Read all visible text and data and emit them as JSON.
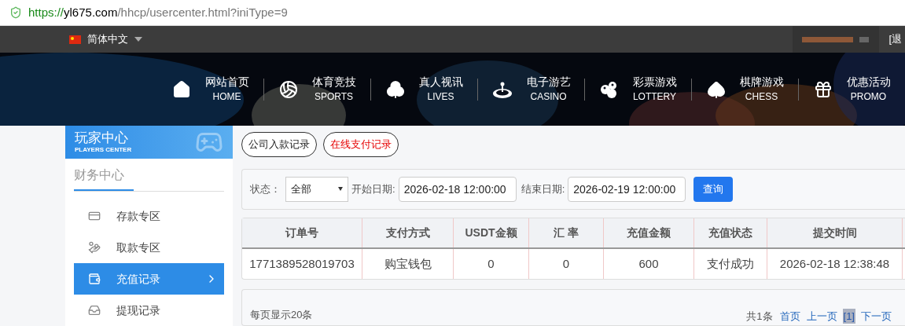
{
  "address_bar": {
    "scheme": "https://",
    "host": "yl675.com",
    "path": "/hhcp/usercenter.html?iniType=9"
  },
  "top_bar": {
    "language": "简体中文",
    "logout": "[退"
  },
  "nav": [
    {
      "kind": "home",
      "zh": "网站首页",
      "en": "HOME"
    },
    {
      "kind": "sports",
      "zh": "体育竞技",
      "en": "SPORTS"
    },
    {
      "kind": "live",
      "zh": "真人视讯",
      "en": "LIVES"
    },
    {
      "kind": "casino",
      "zh": "电子游艺",
      "en": "CASINO"
    },
    {
      "kind": "lottery",
      "zh": "彩票游戏",
      "en": "LOTTERY"
    },
    {
      "kind": "chess",
      "zh": "棋牌游戏",
      "en": "CHESS"
    },
    {
      "kind": "promo",
      "zh": "优惠活动",
      "en": "PROMO"
    }
  ],
  "sidebar": {
    "title": "玩家中心",
    "subtitle": "PLAYERS CENTER",
    "section": "财务中心",
    "items": [
      {
        "kind": "deposit",
        "label": "存款专区",
        "selected": false
      },
      {
        "kind": "withdraw",
        "label": "取款专区",
        "selected": false
      },
      {
        "kind": "recharge",
        "label": "充值记录",
        "selected": true
      },
      {
        "kind": "withdrawals",
        "label": "提现记录",
        "selected": false
      }
    ]
  },
  "tabs": [
    {
      "label": "公司入款记录",
      "selected": false
    },
    {
      "label": "在线支付记录",
      "selected": true
    }
  ],
  "filter": {
    "status_label": "状态：",
    "status_value": "全部",
    "start_label": "开始日期:",
    "start_value": "2026-02-18 12:00:00",
    "end_label": "结束日期:",
    "end_value": "2026-02-19 12:00:00",
    "button": "查询"
  },
  "table": {
    "columns": [
      "订单号",
      "支付方式",
      "USDT金额",
      "汇 率",
      "充值金额",
      "充值状态",
      "提交时间"
    ],
    "rows": [
      [
        "1771389528019703",
        "购宝钱包",
        "0",
        "0",
        "600",
        "支付成功",
        "2026-02-18 12:38:48"
      ]
    ]
  },
  "footer": {
    "page_size": "每页显示20条",
    "total": "共1条",
    "links": [
      {
        "label": "首页",
        "selected": false
      },
      {
        "label": "上一页",
        "selected": false
      },
      {
        "label": "[1]",
        "selected": true
      },
      {
        "label": "下一页",
        "selected": false
      }
    ]
  }
}
